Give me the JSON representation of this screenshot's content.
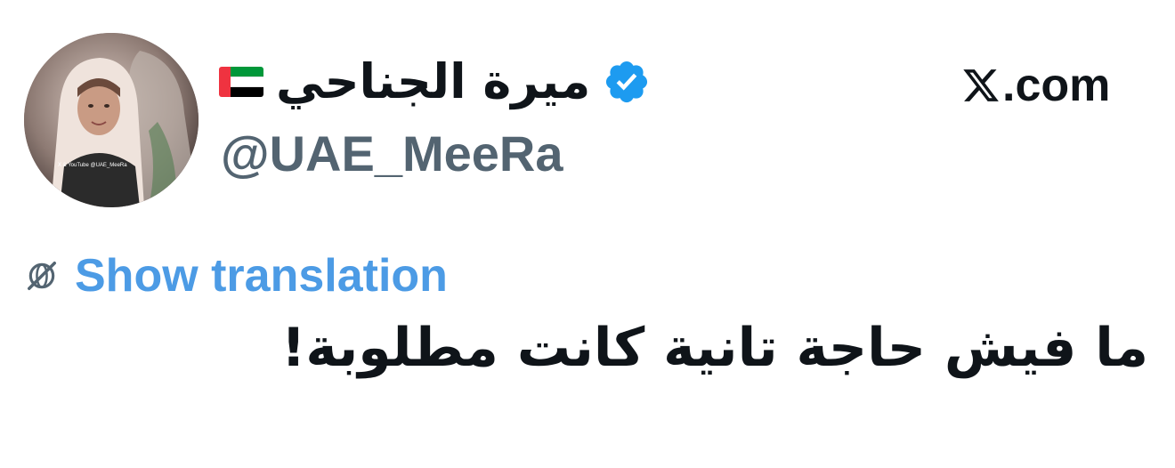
{
  "tweet": {
    "author": {
      "display_name": "ميرة الجناحي",
      "handle": "@UAE_MeeRa",
      "verified": true,
      "flag": "uae-flag-icon",
      "avatar_caption": "X & YouTube @UAE_MeeRa"
    },
    "site_label": ".com",
    "translate_label": "Show translation",
    "body_text": "ما فيش حاجة تانية كانت مطلوبة!",
    "colors": {
      "text": "#0f1419",
      "secondary": "#536471",
      "link": "#4c9be5",
      "verified_badge": "#1d9bf0"
    },
    "icons": {
      "verified": "verified-badge-icon",
      "x_logo": "x-logo-icon",
      "translate": "globe-off-icon"
    }
  }
}
